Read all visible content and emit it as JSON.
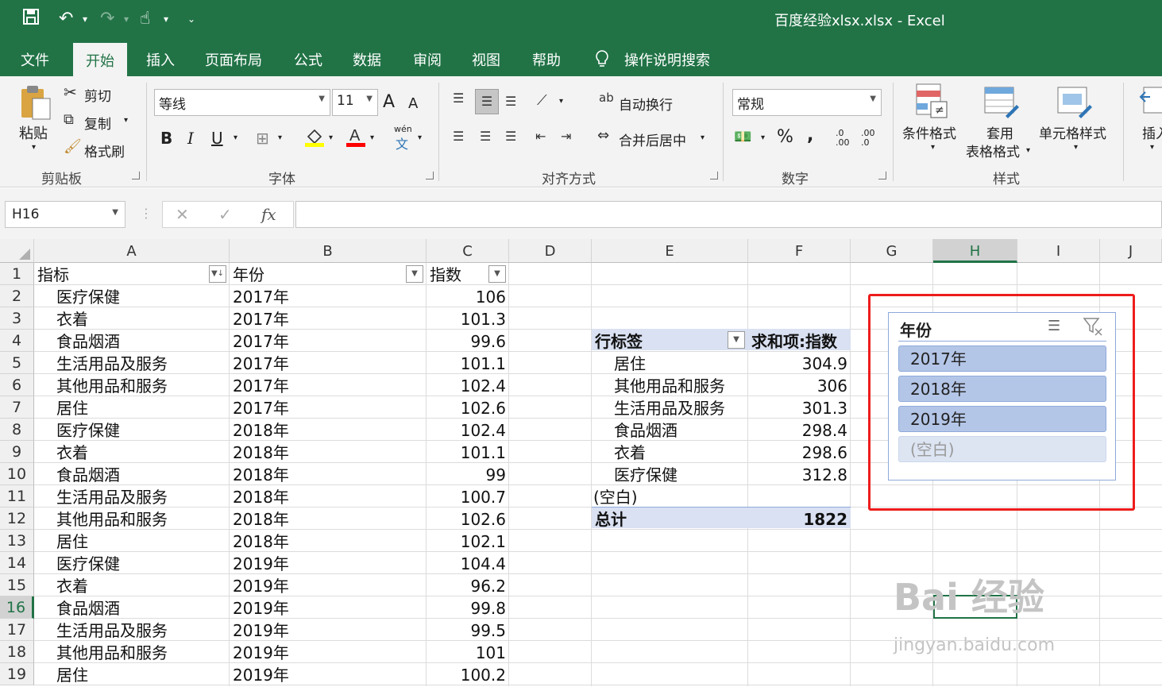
{
  "window": {
    "title": "百度经验xlsx.xlsx  -  Excel"
  },
  "tabs": [
    "文件",
    "开始",
    "插入",
    "页面布局",
    "公式",
    "数据",
    "审阅",
    "视图",
    "帮助"
  ],
  "tell_me": "操作说明搜索",
  "ribbon": {
    "clipboard": {
      "paste": "粘贴",
      "cut": "剪切",
      "copy": "复制",
      "format_painter": "格式刷",
      "label": "剪贴板"
    },
    "font": {
      "name": "等线",
      "size": "11",
      "label": "字体",
      "grow": "A",
      "shrink": "A",
      "bold": "B",
      "italic": "I",
      "underline": "U",
      "phonetic": "wén"
    },
    "alignment": {
      "wrap": "自动换行",
      "merge": "合并后居中",
      "label": "对齐方式"
    },
    "number": {
      "format": "常规",
      "label": "数字",
      "percent": "%",
      "comma": ",",
      "inc": ".0 .00",
      "dec": ".00 .0"
    },
    "styles": {
      "conditional": "条件格式",
      "table_fmt_1": "套用",
      "table_fmt_2": "表格格式",
      "cell_style": "单元格样式",
      "label": "样式"
    },
    "cells": {
      "insert": "插入"
    }
  },
  "namebox": "H16",
  "fx": "fx",
  "columns": [
    "A",
    "B",
    "C",
    "D",
    "E",
    "F",
    "G",
    "H",
    "I",
    "J"
  ],
  "rows": [
    "1",
    "2",
    "3",
    "4",
    "5",
    "6",
    "7",
    "8",
    "9",
    "10",
    "11",
    "12",
    "13",
    "14",
    "15",
    "16",
    "17",
    "18",
    "19"
  ],
  "headers": {
    "a": "指标",
    "b": "年份",
    "c": "指数"
  },
  "data": [
    {
      "a": "医疗保健",
      "b": "2017年",
      "c": "106"
    },
    {
      "a": "衣着",
      "b": "2017年",
      "c": "101.3"
    },
    {
      "a": "食品烟酒",
      "b": "2017年",
      "c": "99.6"
    },
    {
      "a": "生活用品及服务",
      "b": "2017年",
      "c": "101.1"
    },
    {
      "a": "其他用品和服务",
      "b": "2017年",
      "c": "102.4"
    },
    {
      "a": "居住",
      "b": "2017年",
      "c": "102.6"
    },
    {
      "a": "医疗保健",
      "b": "2018年",
      "c": "102.4"
    },
    {
      "a": "衣着",
      "b": "2018年",
      "c": "101.1"
    },
    {
      "a": "食品烟酒",
      "b": "2018年",
      "c": "99"
    },
    {
      "a": "生活用品及服务",
      "b": "2018年",
      "c": "100.7"
    },
    {
      "a": "其他用品和服务",
      "b": "2018年",
      "c": "102.6"
    },
    {
      "a": "居住",
      "b": "2018年",
      "c": "102.1"
    },
    {
      "a": "医疗保健",
      "b": "2019年",
      "c": "104.4"
    },
    {
      "a": "衣着",
      "b": "2019年",
      "c": "96.2"
    },
    {
      "a": "食品烟酒",
      "b": "2019年",
      "c": "99.8"
    },
    {
      "a": "生活用品及服务",
      "b": "2019年",
      "c": "99.5"
    },
    {
      "a": "其他用品和服务",
      "b": "2019年",
      "c": "101"
    },
    {
      "a": "居住",
      "b": "2019年",
      "c": "100.2"
    }
  ],
  "pivot": {
    "row_label": "行标签",
    "value_label": "求和项:指数",
    "rows": [
      {
        "label": "居住",
        "value": "304.9"
      },
      {
        "label": "其他用品和服务",
        "value": "306"
      },
      {
        "label": "生活用品及服务",
        "value": "301.3"
      },
      {
        "label": "食品烟酒",
        "value": "298.4"
      },
      {
        "label": "衣着",
        "value": "298.6"
      },
      {
        "label": "医疗保健",
        "value": "312.8"
      }
    ],
    "blank": "(空白)",
    "total_label": "总计",
    "total_value": "1822"
  },
  "slicer": {
    "title": "年份",
    "items": [
      "2017年",
      "2018年",
      "2019年",
      "(空白)"
    ]
  },
  "watermark": {
    "logo": "Bai 经验",
    "url": "jingyan.baidu.com"
  },
  "colors": {
    "excel_green": "#217346",
    "pivot_band": "#d9e1f2",
    "slicer_selected": "#b4c6e7",
    "highlight": "#ee1c1c"
  }
}
